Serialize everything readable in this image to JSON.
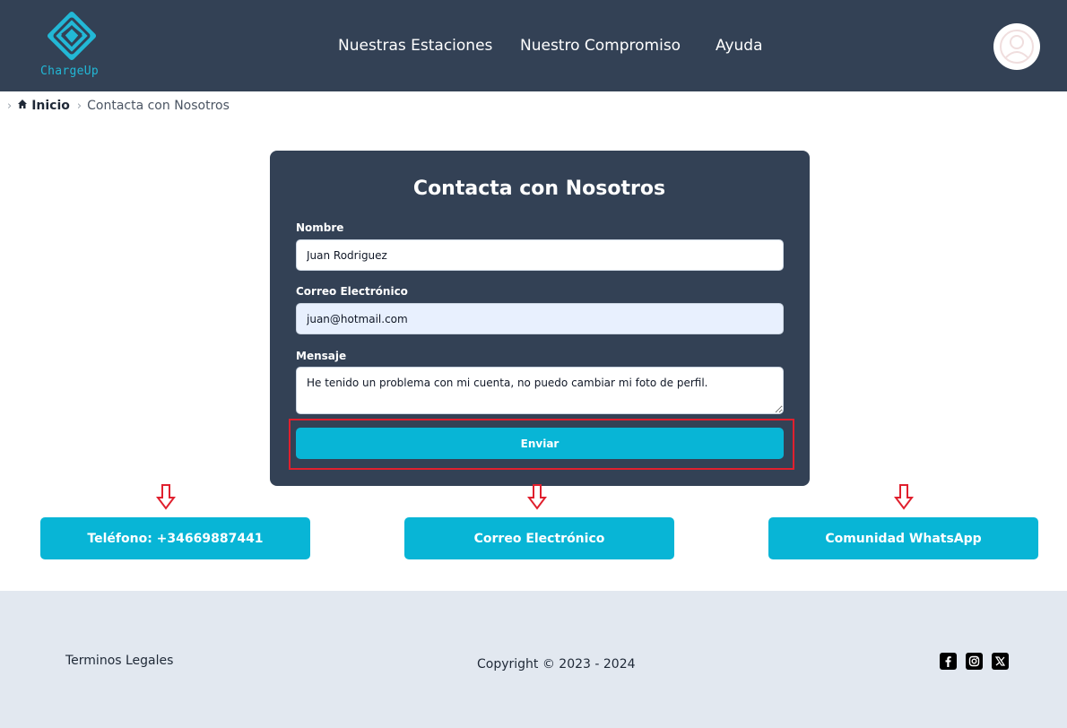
{
  "header": {
    "logo_text": "ChargeUp",
    "nav": [
      "Nuestras Estaciones",
      "Nuestro Compromiso",
      "Ayuda"
    ]
  },
  "breadcrumb": {
    "home": "Inicio",
    "current": "Contacta con Nosotros"
  },
  "form": {
    "title": "Contacta con Nosotros",
    "name_label": "Nombre",
    "name_value": "Juan Rodriguez",
    "email_label": "Correo Electrónico",
    "email_value": "juan@hotmail.com",
    "message_label": "Mensaje",
    "message_value": "He tenido un problema con mi cuenta, no puedo cambiar mi foto de perfil.",
    "submit_label": "Enviar"
  },
  "contacts": {
    "phone": "Teléfono: +34669887441",
    "email": "Correo Electrónico",
    "whatsapp": "Comunidad WhatsApp"
  },
  "footer": {
    "legal": "Terminos Legales",
    "copyright": "Copyright © 2023 - 2024"
  },
  "colors": {
    "header_bg": "#334155",
    "accent": "#08b5d6",
    "footer_bg": "#e2e8f0",
    "highlight": "#e0202e"
  }
}
